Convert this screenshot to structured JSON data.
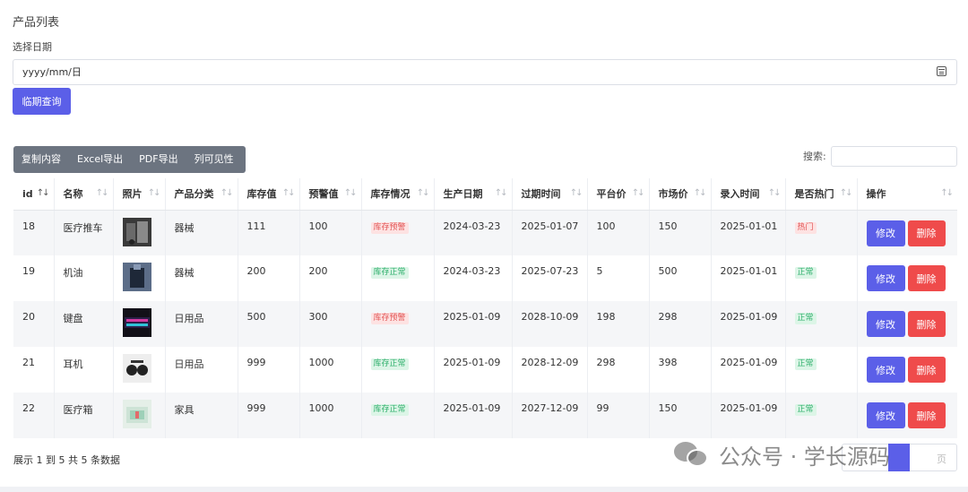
{
  "page": {
    "section_title": "产品列表",
    "date_label": "选择日期",
    "date_placeholder": "yyyy/mm/日",
    "query_button": "临期查询"
  },
  "toolbar": {
    "buttons": [
      "复制内容",
      "Excel导出",
      "PDF导出",
      "列可见性"
    ],
    "search_label": "搜索:"
  },
  "table": {
    "columns": [
      "id",
      "名称",
      "照片",
      "产品分类",
      "库存值",
      "预警值",
      "库存情况",
      "生产日期",
      "过期时间",
      "平台价",
      "市场价",
      "录入时间",
      "是否热门",
      "操作"
    ],
    "rows": [
      {
        "id": "18",
        "name": "医疗推车",
        "photo_icon": "cart-photo",
        "category": "器械",
        "stock": "111",
        "warn": "100",
        "stock_status": "库存预警",
        "status_type": "warn",
        "produced": "2024-03-23",
        "expires": "2025-01-07",
        "platform_price": "100",
        "market_price": "150",
        "entered": "2025-01-01",
        "hot": "热门",
        "hot_type": "warn"
      },
      {
        "id": "19",
        "name": "机油",
        "photo_icon": "oil-photo",
        "category": "器械",
        "stock": "200",
        "warn": "200",
        "stock_status": "库存正常",
        "status_type": "ok",
        "produced": "2024-03-23",
        "expires": "2025-07-23",
        "platform_price": "5",
        "market_price": "500",
        "entered": "2025-01-01",
        "hot": "正常",
        "hot_type": "ok"
      },
      {
        "id": "20",
        "name": "键盘",
        "photo_icon": "keyboard-photo",
        "category": "日用品",
        "stock": "500",
        "warn": "300",
        "stock_status": "库存预警",
        "status_type": "warn",
        "produced": "2025-01-09",
        "expires": "2028-10-09",
        "platform_price": "198",
        "market_price": "298",
        "entered": "2025-01-09",
        "hot": "正常",
        "hot_type": "ok"
      },
      {
        "id": "21",
        "name": "耳机",
        "photo_icon": "headphone-photo",
        "category": "日用品",
        "stock": "999",
        "warn": "1000",
        "stock_status": "库存正常",
        "status_type": "ok",
        "produced": "2025-01-09",
        "expires": "2028-12-09",
        "platform_price": "298",
        "market_price": "398",
        "entered": "2025-01-09",
        "hot": "正常",
        "hot_type": "ok"
      },
      {
        "id": "22",
        "name": "医疗箱",
        "photo_icon": "medical-box-photo",
        "category": "家具",
        "stock": "999",
        "warn": "1000",
        "stock_status": "库存正常",
        "status_type": "ok",
        "produced": "2025-01-09",
        "expires": "2027-12-09",
        "platform_price": "99",
        "market_price": "150",
        "entered": "2025-01-09",
        "hot": "正常",
        "hot_type": "ok"
      }
    ],
    "edit_label": "修改",
    "delete_label": "删除"
  },
  "footer": {
    "summary": "展示 1 到 5 共 5 条数据",
    "pager_current": "1",
    "pager_next": "页"
  },
  "watermark": {
    "text": "公众号 · 学长源码"
  },
  "colors": {
    "primary": "#5b5fe8",
    "danger": "#ef4b4b",
    "toolbar_bg": "#6c7480",
    "warn_badge_bg": "#fde2e2",
    "ok_badge_bg": "#dcf5e7"
  }
}
